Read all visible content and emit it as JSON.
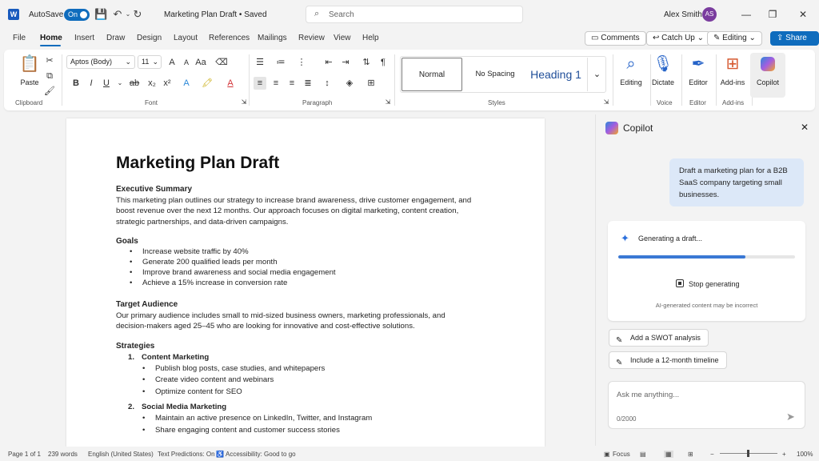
{
  "titlebar": {
    "autosave_label": "AutoSave",
    "autosave_state": "On",
    "doc_title": "Marketing Plan Draft • Saved",
    "search_placeholder": "Search",
    "user_name": "Alex Smith",
    "user_initials": "AS"
  },
  "tabs": [
    "File",
    "Home",
    "Insert",
    "Draw",
    "Design",
    "Layout",
    "References",
    "Mailings",
    "Review",
    "View",
    "Help"
  ],
  "actions": {
    "comments": "Comments",
    "catch_up": "Catch Up",
    "editing": "Editing",
    "share": "Share"
  },
  "ribbon": {
    "paste": "Paste",
    "font_name": "Aptos (Body)",
    "font_size": "11",
    "styles": [
      "Normal",
      "No Spacing",
      "Heading 1"
    ],
    "buttons": {
      "editing": "Editing",
      "dictate": "Dictate",
      "editor": "Editor",
      "addins": "Add-ins",
      "copilot": "Copilot"
    },
    "groups": {
      "clipboard": "Clipboard",
      "font": "Font",
      "paragraph": "Paragraph",
      "styles": "Styles",
      "voice": "Voice",
      "editor": "Editor",
      "addins": "Add-ins"
    }
  },
  "document": {
    "title": "Marketing Plan Draft",
    "exec_heading": "Executive Summary",
    "exec_lines": [
      "This marketing plan outlines our strategy to increase brand awareness, drive customer engagement, and",
      "boost revenue over the next 12 months. Our approach focuses on digital marketing, content creation,",
      "strategic partnerships, and data-driven campaigns."
    ],
    "goals_heading": "Goals",
    "goals": [
      "Increase website traffic by 40%",
      "Generate 200 qualified leads per month",
      "Improve brand awareness and social media engagement",
      "Achieve a 15% increase in conversion rate"
    ],
    "audience_heading": "Target Audience",
    "audience_lines": [
      "Our primary audience includes small to mid-sized business owners, marketing professionals, and",
      "decision-makers aged 25–45 who are looking for innovative and cost-effective solutions."
    ],
    "strategies_heading": "Strategies",
    "strategy1_num": "1.",
    "strategy1": "Content Marketing",
    "strategy1_items": [
      "Publish blog posts, case studies, and whitepapers",
      "Create video content and webinars",
      "Optimize content for SEO"
    ],
    "strategy2_num": "2.",
    "strategy2": "Social Media Marketing",
    "strategy2_items": [
      "Maintain an active presence on LinkedIn, Twitter, and Instagram",
      "Share engaging content and customer success stories"
    ]
  },
  "copilot": {
    "title": "Copilot",
    "prompt_lines": [
      "Draft a marketing plan for a B2B",
      "SaaS company targeting small",
      "businesses."
    ],
    "generating": "Generating a draft...",
    "progress": 0.72,
    "stop": "Stop generating",
    "disclaimer": "AI-generated content may be incorrect",
    "suggestions": [
      "Add a SWOT analysis",
      "Include a 12-month timeline"
    ],
    "ask_placeholder": "Ask me anything...",
    "char_count": "0/2000"
  },
  "statusbar": {
    "page": "Page 1 of 1",
    "words": "239 words",
    "language": "English (United States)",
    "predictions": "Text Predictions: On",
    "accessibility": "Accessibility: Good to go",
    "focus": "Focus",
    "zoom": "100%"
  },
  "colors": {
    "accent": "#0f6cbd",
    "avatar": "#7a3c9e",
    "progress": "#3a78d4"
  }
}
